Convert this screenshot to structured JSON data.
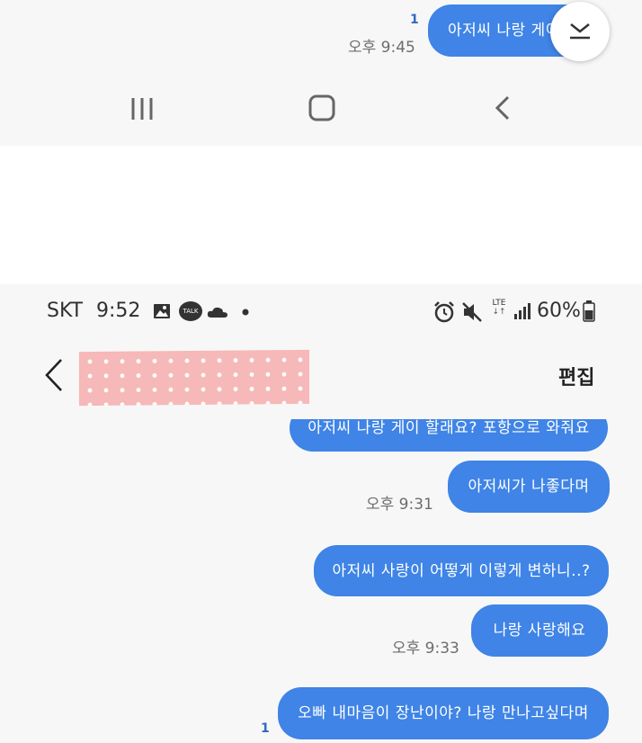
{
  "top_chat": {
    "unread": "1",
    "time": "오후 9:45",
    "message": "아저씨 나랑 게이",
    "scroll_down_icon": "chevron-down-line-icon"
  },
  "nav_bar": {
    "recents_icon": "recents-icon",
    "home_icon": "home-icon",
    "back_icon": "back-icon"
  },
  "status_bar": {
    "carrier": "SKT",
    "time": "9:52",
    "talk_label": "TALK",
    "network": "LTE",
    "battery": "60%"
  },
  "header": {
    "edit_label": "편집"
  },
  "messages": [
    {
      "text": "아저씨 나랑 게이 할래요? 포항으로 와줘요",
      "time": ""
    },
    {
      "text": "아저씨가 나좋다며",
      "time": "오후 9:31"
    },
    {
      "text": "아저씨 사랑이 어떻게 이렇게 변하니..?",
      "time": ""
    },
    {
      "text": "나랑 사랑해요",
      "time": "오후 9:33"
    },
    {
      "text": "오빠 내마음이 장난이야? 나랑 만나고싶다며",
      "unread": "1"
    }
  ],
  "colors": {
    "bubble": "#3f84e6",
    "background": "#f7f7f7",
    "unread": "#2e6bbf",
    "tape": "#f6b8b8"
  }
}
